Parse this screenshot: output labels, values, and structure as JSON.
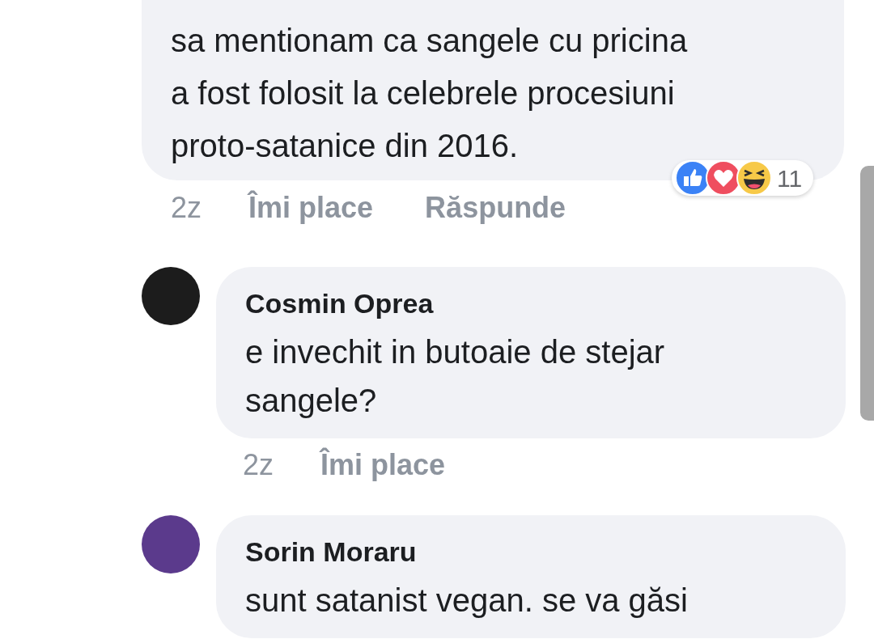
{
  "comments": [
    {
      "lines": [
        "sa mentionam ca sangele cu pricina",
        "a fost folosit la celebrele procesiuni",
        "proto-satanice din 2016."
      ],
      "time": "2z",
      "actions": [
        "Îmi place",
        "Răspunde"
      ],
      "reactions": {
        "icons": [
          {
            "kind": "like"
          },
          {
            "kind": "love"
          },
          {
            "kind": "haha"
          }
        ],
        "count": "11"
      }
    },
    {
      "author": "Cosmin Oprea",
      "lines": [
        "e invechit in butoaie de stejar",
        "sangele?"
      ],
      "time": "2z",
      "actions": [
        "Îmi place"
      ]
    },
    {
      "author": "Sorin Moraru",
      "lines": [
        "sunt satanist vegan. se va găsi"
      ]
    }
  ]
}
